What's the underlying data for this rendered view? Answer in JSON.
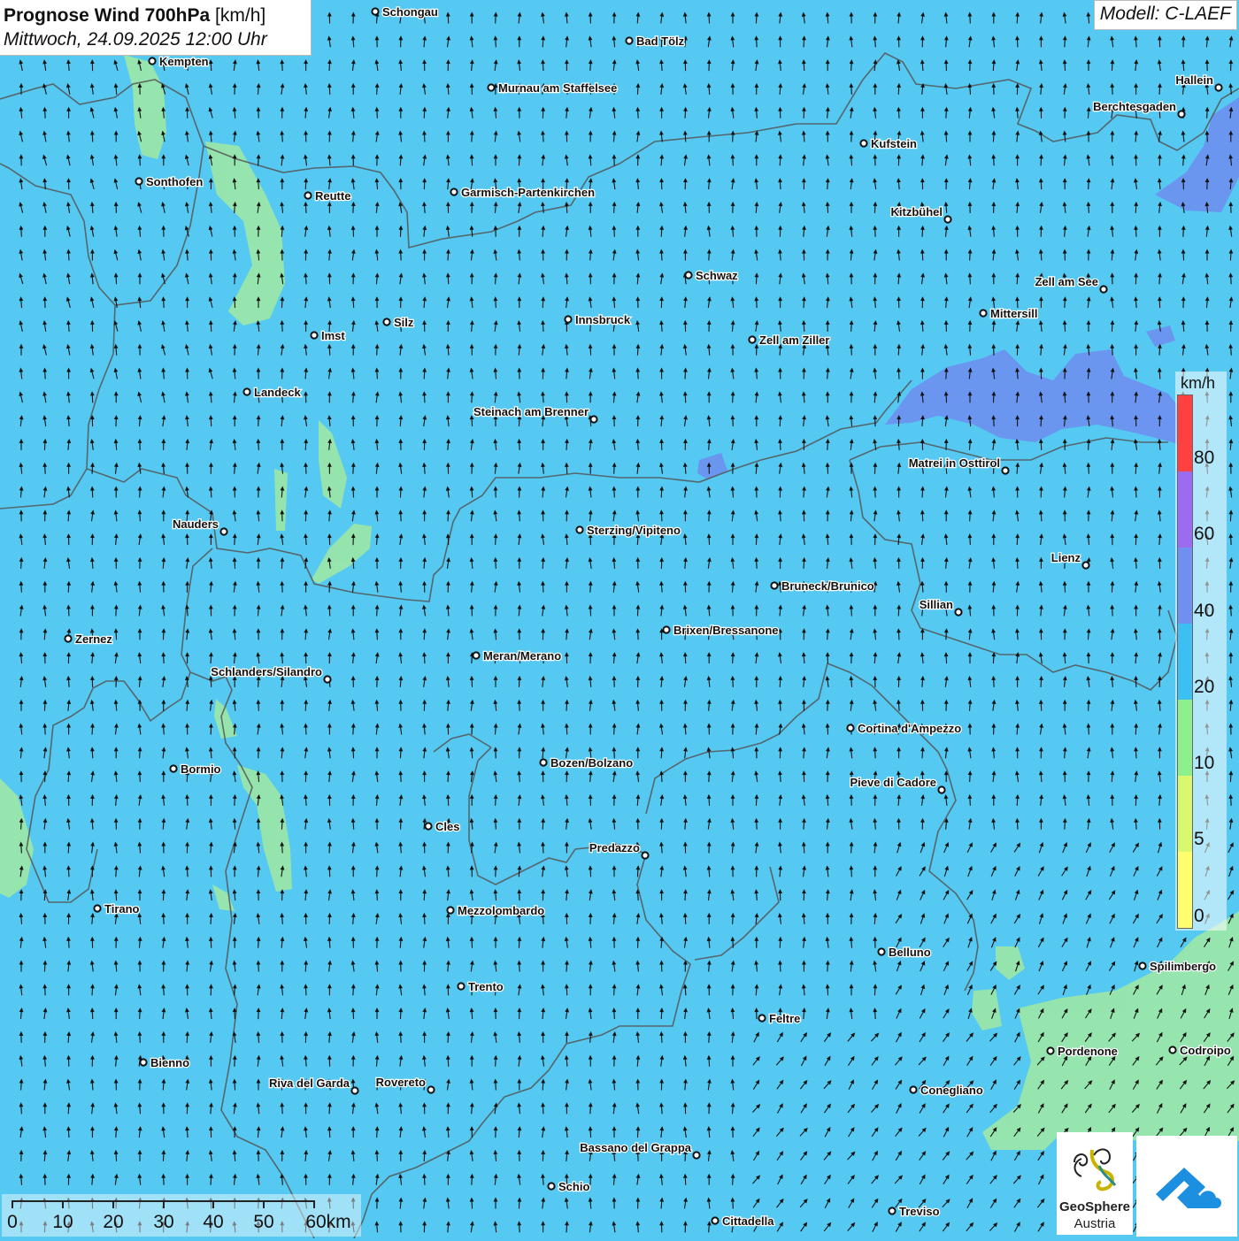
{
  "header": {
    "title_bold": "Prognose Wind 700hPa",
    "title_unit": "[km/h]",
    "datetime": "Mittwoch, 24.09.2025 12:00 Uhr",
    "model": "Modell: C-LAEF"
  },
  "legend": {
    "unit": "km/h",
    "ticks": [
      "80",
      "60",
      "40",
      "20",
      "10",
      "5",
      "0"
    ],
    "colors": [
      "#ff4040",
      "#9a6cf0",
      "#6f90f0",
      "#3cc0f4",
      "#8ef08c",
      "#d8f870",
      "#ffff70"
    ]
  },
  "scale": {
    "labels": [
      "0",
      "10",
      "20",
      "30",
      "40",
      "50",
      "60km"
    ]
  },
  "logos": {
    "geosphere_line1": "GeoSphere",
    "geosphere_line2": "Austria",
    "geosphere_icon": "geosphere-swirl-icon",
    "app_icon": "warn-app-cloud-icon"
  },
  "colors": {
    "background": "#55c9f2",
    "calm_zone": "#9de8a6",
    "strong_zone": "#6f8df0",
    "border": "#555555"
  },
  "cities": [
    "Schongau",
    "Bad Tölz",
    "Kempten",
    "Murnau am Staffelsee",
    "Hallein",
    "Berchtesgaden",
    "Kufstein",
    "Sonthofen",
    "Reutte",
    "Garmisch-Partenkirchen",
    "Kitzbühel",
    "Schwaz",
    "Zell am See",
    "Mittersill",
    "Innsbruck",
    "Silz",
    "Imst",
    "Zell am Ziller",
    "Landeck",
    "Steinach am Brenner",
    "Matrei in Osttirol",
    "Nauders",
    "Sterzing/Vipiteno",
    "Lienz",
    "Bruneck/Brunico",
    "Sillian",
    "Brixen/Bressanone",
    "Zernez",
    "Meran/Merano",
    "Schlanders/Silandro",
    "Cortina d'Ampezzo",
    "Bozen/Bolzano",
    "Bormio",
    "Pieve di Cadore",
    "Cles",
    "Predazzo",
    "Tirano",
    "Mezzolombardo",
    "Belluno",
    "Spilimbergo",
    "Trento",
    "Feltre",
    "Pordenone",
    "Codroipo",
    "Bienno",
    "Riva del Garda",
    "Rovereto",
    "Conegliano",
    "Bassano del Grappa",
    "Schio",
    "Treviso",
    "Cittadella"
  ]
}
